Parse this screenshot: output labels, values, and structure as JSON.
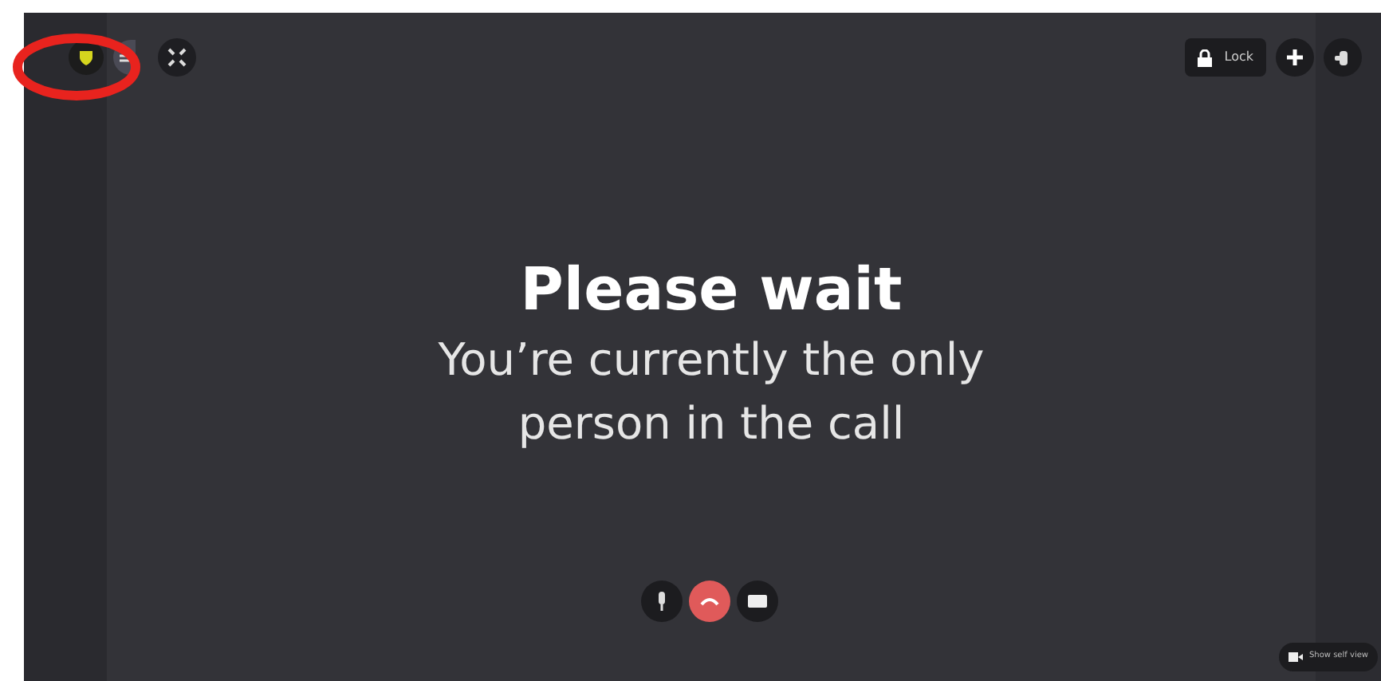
{
  "toolbar": {
    "lock_label": "Lock"
  },
  "message": {
    "title": "Please wait",
    "subtitle": "You’re currently the only person in the call"
  },
  "self_view": {
    "label": "Show self view"
  }
}
